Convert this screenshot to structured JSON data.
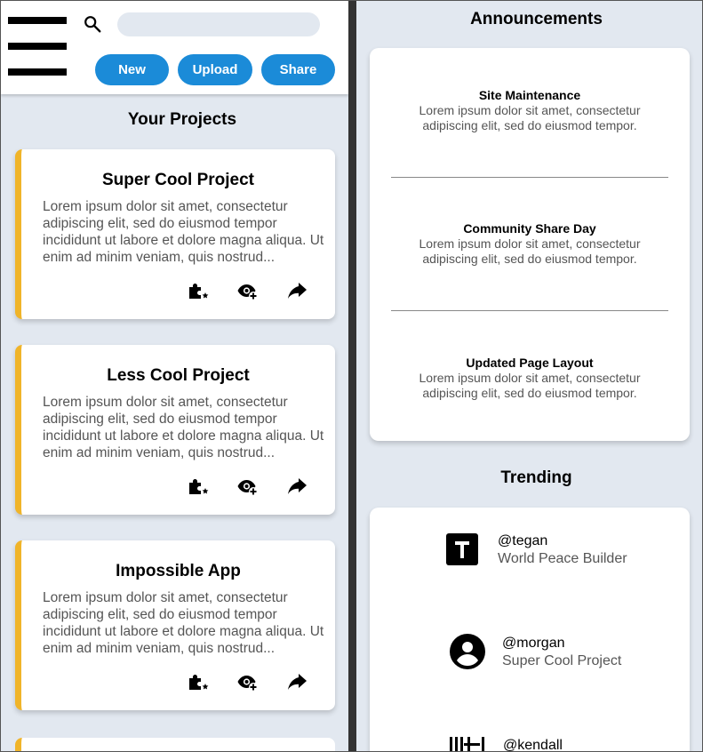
{
  "header": {
    "search_placeholder": "",
    "buttons": {
      "new": "New",
      "upload": "Upload",
      "share": "Share"
    }
  },
  "projects": {
    "title": "Your Projects",
    "items": [
      {
        "title": "Super Cool Project",
        "description": "Lorem ipsum dolor sit amet, consectetur adipiscing elit, sed do eiusmod tempor incididunt ut labore et dolore magna aliqua. Ut enim ad minim veniam, quis nostrud..."
      },
      {
        "title": "Less Cool Project",
        "description": "Lorem ipsum dolor sit amet, consectetur adipiscing elit, sed do eiusmod tempor incididunt ut labore et dolore magna aliqua. Ut enim ad minim veniam, quis nostrud..."
      },
      {
        "title": "Impossible App",
        "description": "Lorem ipsum dolor sit amet, consectetur adipiscing elit, sed do eiusmod tempor incididunt ut labore et dolore magna aliqua. Ut enim ad minim veniam, quis nostrud..."
      }
    ],
    "icons": [
      "extension-star-icon",
      "watch-add-icon",
      "share-arrow-icon"
    ]
  },
  "announcements": {
    "title": "Announcements",
    "items": [
      {
        "title": "Site Maintenance",
        "line1": "Lorem ipsum dolor sit amet, consectetur",
        "line2": "adipiscing elit, sed do eiusmod tempor."
      },
      {
        "title": "Community Share Day",
        "line1": "Lorem ipsum dolor sit amet, consectetur",
        "line2": "adipiscing elit, sed do eiusmod tempor."
      },
      {
        "title": "Updated Page Layout",
        "line1": "Lorem ipsum dolor sit amet, consectetur",
        "line2": "adipiscing elit, sed do eiusmod tempor."
      }
    ]
  },
  "trending": {
    "title": "Trending",
    "items": [
      {
        "handle": "@tegan",
        "subtitle": "World Peace Builder",
        "avatar_icon": "letter-t-icon"
      },
      {
        "handle": "@morgan",
        "subtitle": "Super Cool Project",
        "avatar_icon": "account-circle-icon"
      },
      {
        "handle": "@kendall",
        "subtitle": "",
        "avatar_icon": "barcode-icon"
      }
    ]
  },
  "colors": {
    "accent": "#1b8bd8",
    "card_stripe": "#f0b429",
    "background": "#e2e8f0",
    "divider": "#333333"
  }
}
